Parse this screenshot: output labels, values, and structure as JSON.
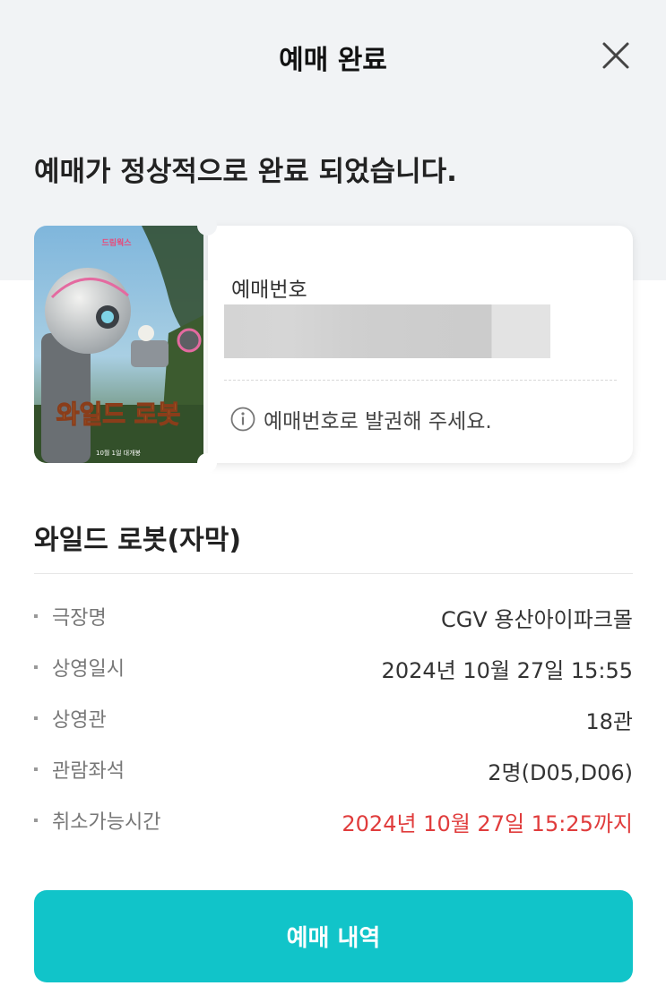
{
  "header": {
    "title": "예매 완료",
    "close_icon": "close-icon"
  },
  "confirmation": {
    "message": "예매가 정상적으로 완료 되었습니다."
  },
  "poster": {
    "title_text": "와일드 로봇",
    "release_text": "10월 1일 대개봉"
  },
  "ticket": {
    "reservation_label": "예매번호",
    "reservation_number_masked": true,
    "notice_icon": "info-icon",
    "notice": "예매번호로 발권해 주세요."
  },
  "movie": {
    "title": "와일드 로봇(자막)"
  },
  "details": [
    {
      "key": "극장명",
      "value": "CGV 용산아이파크몰"
    },
    {
      "key": "상영일시",
      "value": "2024년 10월 27일 15:55"
    },
    {
      "key": "상영관",
      "value": "18관"
    },
    {
      "key": "관람좌석",
      "value": "2명(D05,D06)"
    },
    {
      "key": "취소가능시간",
      "value": "2024년 10월 27일 15:25까지",
      "highlight": true
    }
  ],
  "actions": {
    "history_button": "예매 내역"
  },
  "colors": {
    "accent": "#11c4c9",
    "alert": "#e03c3c",
    "top_background": "#f1f3f5"
  }
}
